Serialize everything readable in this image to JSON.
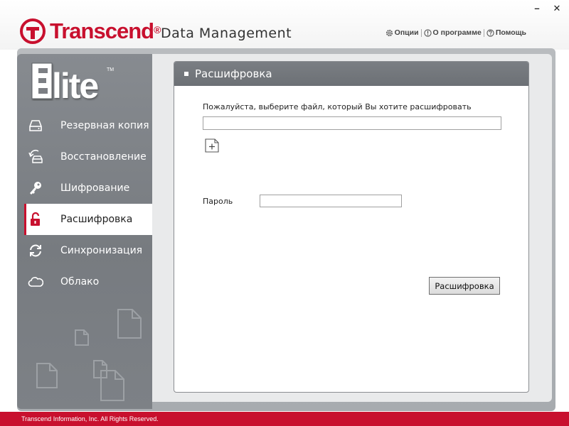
{
  "header": {
    "brand_name": "Transcend",
    "brand_registered": "®",
    "app_title": "Data Management",
    "window_controls": {
      "minimize": "–",
      "close": "✕"
    },
    "top_links": [
      {
        "label": "Опции",
        "icon": "gear-icon"
      },
      {
        "label": "О программе",
        "icon": "info-icon"
      },
      {
        "label": "Помощь",
        "icon": "help-icon"
      }
    ]
  },
  "sidebar": {
    "logo_text": "Elite",
    "logo_tm": "TM",
    "items": [
      {
        "label": "Резервная копия",
        "icon": "backup-drive-icon",
        "active": false
      },
      {
        "label": "Восстановление",
        "icon": "restore-icon",
        "active": false
      },
      {
        "label": "Шифрование",
        "icon": "key-icon",
        "active": false
      },
      {
        "label": "Расшифровка",
        "icon": "unlock-icon",
        "active": true
      },
      {
        "label": "Синхронизация",
        "icon": "sync-icon",
        "active": false
      },
      {
        "label": "Облако",
        "icon": "cloud-icon",
        "active": false
      }
    ]
  },
  "panel": {
    "title": "Расшифровка",
    "file_prompt": "Пожалуйста, выберите файл, который Вы хотите расшифровать",
    "file_value": "",
    "add_file_icon": "add-file-icon",
    "password_label": "Пароль",
    "password_value": "",
    "decrypt_button": "Расшифровка"
  },
  "footer": {
    "copyright": "Transcend Information, Inc. All Rights Reserved."
  },
  "colors": {
    "brand_red": "#c8102e",
    "sidebar_gray": "#7f8388",
    "panel_header_gray": "#74787d"
  }
}
